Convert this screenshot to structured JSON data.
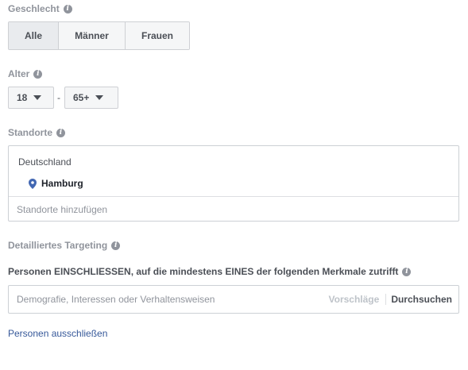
{
  "gender": {
    "label": "Geschlecht",
    "options": [
      "Alle",
      "Männer",
      "Frauen"
    ],
    "selected": "Alle"
  },
  "age": {
    "label": "Alter",
    "min": "18",
    "separator": "-",
    "max": "65+"
  },
  "locations": {
    "label": "Standorte",
    "country": "Deutschland",
    "items": [
      "Hamburg"
    ],
    "placeholder": "Standorte hinzufügen"
  },
  "detailed_targeting": {
    "label": "Detailliertes Targeting",
    "include_text": "Personen EINSCHLIESSEN, auf die mindestens EINES der folgenden Merkmale zutrifft",
    "placeholder": "Demografie, Interessen oder Verhaltensweisen",
    "suggestions_label": "Vorschläge",
    "browse_label": "Durchsuchen",
    "exclude_link": "Personen ausschließen"
  },
  "icons": {
    "info": "info-icon",
    "caret": "caret-down-icon",
    "location": "map-pin-icon"
  },
  "colors": {
    "label_gray": "#90949c",
    "link_blue": "#365899",
    "pin_blue": "#4267b2",
    "border": "#ccd0d5"
  }
}
